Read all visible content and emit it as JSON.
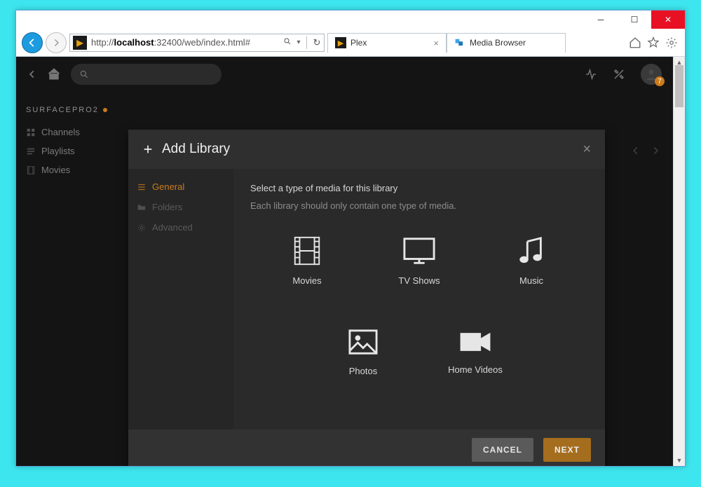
{
  "browser": {
    "url_pre": "http://",
    "url_host": "localhost",
    "url_post": ":32400/web/index.html#",
    "tabs": [
      {
        "title": "Plex",
        "icon_color": "#e5a00d",
        "active": true
      },
      {
        "title": "Media Browser",
        "icon_color": "#1d9be0",
        "active": false
      }
    ]
  },
  "plex": {
    "server_name": "SURFACEPRO2",
    "badge_count": "7",
    "sidebar": {
      "items": [
        {
          "label": "Channels"
        },
        {
          "label": "Playlists"
        },
        {
          "label": "Movies"
        }
      ]
    }
  },
  "modal": {
    "title": "Add Library",
    "steps": {
      "general": "General",
      "folders": "Folders",
      "advanced": "Advanced"
    },
    "instruction_title": "Select a type of media for this library",
    "instruction_sub": "Each library should only contain one type of media.",
    "media_types": {
      "movies": "Movies",
      "tvshows": "TV Shows",
      "music": "Music",
      "photos": "Photos",
      "homevideos": "Home Videos"
    },
    "buttons": {
      "cancel": "CANCEL",
      "next": "NEXT"
    }
  }
}
